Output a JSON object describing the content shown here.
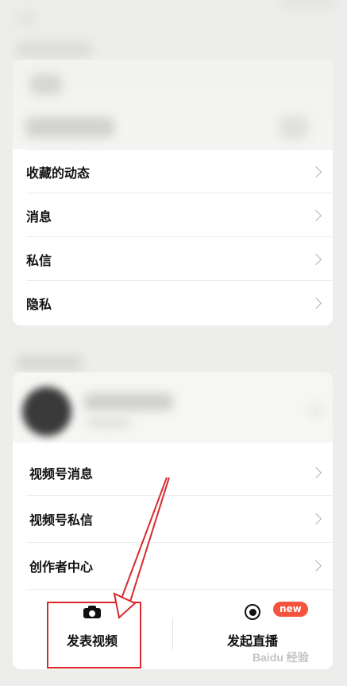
{
  "settings_card": {
    "items": [
      {
        "label": "收藏的动态"
      },
      {
        "label": "消息"
      },
      {
        "label": "私信"
      },
      {
        "label": "隐私"
      }
    ]
  },
  "channels_card": {
    "items": [
      {
        "label": "视频号消息"
      },
      {
        "label": "视频号私信"
      },
      {
        "label": "创作者中心"
      }
    ],
    "actions": {
      "post_video": {
        "label": "发表视频",
        "icon": "camera-icon"
      },
      "start_live": {
        "label": "发起直播",
        "icon": "live-record-icon",
        "badge": "new"
      }
    }
  },
  "annotation": {
    "color": "#d8282c"
  },
  "watermark": {
    "text": "Baidu 经验"
  }
}
